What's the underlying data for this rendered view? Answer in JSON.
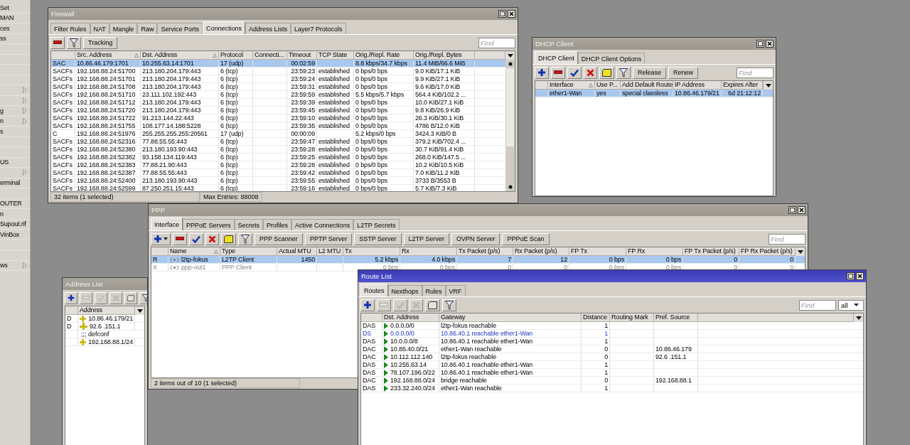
{
  "sidebar": {
    "items": [
      {
        "label": "Set",
        "submenu": false
      },
      {
        "label": "MAN",
        "submenu": false
      },
      {
        "label": "ces",
        "submenu": false
      },
      {
        "label": "ss",
        "submenu": false
      },
      {
        "submenu": false
      },
      {
        "submenu": false
      },
      {
        "submenu": false
      },
      {
        "submenu": false
      },
      {
        "submenu": true
      },
      {
        "submenu": true
      },
      {
        "label": "g",
        "submenu": true
      },
      {
        "label": "n",
        "submenu": true
      },
      {
        "label": "s",
        "submenu": false
      },
      {
        "submenu": false
      },
      {
        "submenu": false
      },
      {
        "label": "US",
        "submenu": false
      },
      {
        "submenu": true
      },
      {
        "label": "erminal",
        "submenu": false
      },
      {
        "submenu": false
      },
      {
        "label": "OUTER",
        "submenu": false
      },
      {
        "label": "n",
        "submenu": false
      },
      {
        "label": "Supout.rif",
        "submenu": false
      },
      {
        "label": "VinBox",
        "submenu": false
      },
      {
        "submenu": false
      },
      {
        "submenu": false
      },
      {
        "label": "ws",
        "submenu": true
      }
    ]
  },
  "windows": [
    {
      "kind": "firewall",
      "title": "Firewall",
      "active": false,
      "tabs": [
        {
          "label": "Filter Rules",
          "selected": false
        },
        {
          "label": "NAT",
          "selected": false
        },
        {
          "label": "Mangle",
          "selected": false
        },
        {
          "label": "Raw",
          "selected": false
        },
        {
          "label": "Service Ports",
          "selected": false
        },
        {
          "label": "Connections",
          "selected": true
        },
        {
          "label": "Address Lists",
          "selected": false
        },
        {
          "label": "Layer7 Protocols",
          "selected": false
        }
      ],
      "toolbar": [
        {
          "kind": "remove",
          "disabled": false
        },
        {
          "kind": "filter",
          "disabled": false
        },
        {
          "kind": "text",
          "label": "Tracking",
          "disabled": false
        }
      ],
      "find": {
        "placeholder": "Find"
      },
      "table": {
        "columns": [
          {
            "kind": "text",
            "sorted": false
          },
          {
            "label": "Src. Address",
            "kind": "text",
            "sorted": true
          },
          {
            "label": "Dst. Address",
            "kind": "text",
            "sorted": true
          },
          {
            "label": "Protocol",
            "kind": "text",
            "sorted": false
          },
          {
            "label": "Connecti...",
            "kind": "text",
            "sorted": false
          },
          {
            "label": "Timeout",
            "kind": "number",
            "sorted": false
          },
          {
            "label": "TCP State",
            "kind": "text",
            "sorted": false
          },
          {
            "label": "Orig./Repl. Rate",
            "kind": "text",
            "sorted": false
          },
          {
            "label": "Orig./Repl. Bytes",
            "kind": "text",
            "sorted": false
          }
        ],
        "rows": [
          {
            "selected": true,
            "cells": [
              "SAC",
              "10.86.46.179:1701",
              "10.255.63.14:1701",
              "17 (udp)",
              null,
              "00:02:59",
              null,
              "8.8 kbps/34.7 kbps",
              "11.4 MiB/66.6 MiB"
            ]
          },
          {
            "selected": false,
            "cells": [
              "SACFs",
              "192.168.88.24:51700",
              "213.180.204.179:443",
              "6 (tcp)",
              null,
              "23:59:23",
              "established",
              "0 bps/0 bps",
              "9.0 KiB/17.1 KiB"
            ]
          },
          {
            "selected": false,
            "cells": [
              "SACFs",
              "192.168.88.24:51701",
              "213.180.204.179:443",
              "6 (tcp)",
              null,
              "23:59:24",
              "established",
              "0 bps/0 bps",
              "9.9 KiB/27.1 KiB"
            ]
          },
          {
            "selected": false,
            "cells": [
              "SACFs",
              "192.168.88.24:51708",
              "213.180.204.179:443",
              "6 (tcp)",
              null,
              "23:59:31",
              "established",
              "0 bps/0 bps",
              "9.6 KiB/17.0 KiB"
            ]
          },
          {
            "selected": false,
            "cells": [
              "SACFs",
              "192.168.88.24:51710",
              "23.111.102.192:443",
              "6 (tcp)",
              null,
              "23:59:59",
              "established",
              "5.5 kbps/5.7 kbps",
              "564.4 KiB/102.2 ..."
            ]
          },
          {
            "selected": false,
            "cells": [
              "SACFs",
              "192.168.88.24:51712",
              "213.180.204.179:443",
              "6 (tcp)",
              null,
              "23:59:39",
              "established",
              "0 bps/0 bps",
              "10.0 KiB/27.1 KiB"
            ]
          },
          {
            "selected": false,
            "cells": [
              "SACFs",
              "192.168.88.24:51720",
              "213.180.204.179:443",
              "6 (tcp)",
              null,
              "23:59:45",
              "established",
              "0 bps/0 bps",
              "9.8 KiB/26.9 KiB"
            ]
          },
          {
            "selected": false,
            "cells": [
              "SACFs",
              "192.168.88.24:51722",
              "91.213.144.22:443",
              "6 (tcp)",
              null,
              "23:59:10",
              "established",
              "0 bps/0 bps",
              "26.3 KiB/30.1 KiB"
            ]
          },
          {
            "selected": false,
            "cells": [
              "SACFs",
              "192.168.88.24:51755",
              "108.177.14.188:5228",
              "6 (tcp)",
              null,
              "23:59:35",
              "established",
              "0 bps/0 bps",
              "4786 B/12.0 KiB"
            ]
          },
          {
            "selected": false,
            "cells": [
              "C",
              "192.168.88.24:51976",
              "255.255.255.255:20561",
              "17 (udp)",
              null,
              "00:00:09",
              null,
              "5.2 kbps/0 bps",
              "3424.3 KiB/0 B"
            ]
          },
          {
            "selected": false,
            "cells": [
              "SACFs",
              "192.168.88.24:52316",
              "77.88.55.55:443",
              "6 (tcp)",
              null,
              "23:59:47",
              "established",
              "0 bps/0 bps",
              "379.2 KiB/702.4 ..."
            ]
          },
          {
            "selected": false,
            "cells": [
              "SACFs",
              "192.168.88.24:52380",
              "213.180.193.90:443",
              "6 (tcp)",
              null,
              "23:59:28",
              "established",
              "0 bps/0 bps",
              "30.7 KiB/91.4 KiB"
            ]
          },
          {
            "selected": false,
            "cells": [
              "SACFs",
              "192.168.88.24:52382",
              "93.158.134.119:443",
              "6 (tcp)",
              null,
              "23:59:25",
              "established",
              "0 bps/0 bps",
              "268.0 KiB/147.5 ..."
            ]
          },
          {
            "selected": false,
            "cells": [
              "SACFs",
              "192.168.88.24:52383",
              "77.88.21.90:443",
              "6 (tcp)",
              null,
              "23:59:28",
              "established",
              "0 bps/0 bps",
              "10.2 KiB/10.5 KiB"
            ]
          },
          {
            "selected": false,
            "cells": [
              "SACFs",
              "192.168.88.24:52387",
              "77.88.55.55:443",
              "6 (tcp)",
              null,
              "23:59:42",
              "established",
              "0 bps/0 bps",
              "7.0 KiB/11.2 KiB"
            ]
          },
          {
            "selected": false,
            "cells": [
              "SACFs",
              "192.168.88.24:52400",
              "213.180.193.90:443",
              "6 (tcp)",
              null,
              "23:59:55",
              "established",
              "0 bps/0 bps",
              "3733 B/3553 B"
            ]
          },
          {
            "selected": false,
            "cells": [
              "SACFs",
              "192.168.88.24:52599",
              "87.250.251.15:443",
              "6 (tcp)",
              null,
              "23:59:16",
              "established",
              "0 bps/0 bps",
              "5.7 KiB/7.3 KiB"
            ]
          }
        ]
      },
      "status_bar": [
        "32 items (1 selected)",
        "Max Entries: 88008"
      ]
    },
    {
      "kind": "dhcp",
      "title": "DHCP Client",
      "active": false,
      "tabs": [
        {
          "label": "DHCP Client",
          "selected": true
        },
        {
          "label": "DHCP Client Options",
          "selected": false
        }
      ],
      "toolbar": [
        {
          "kind": "add",
          "disabled": false
        },
        {
          "kind": "remove",
          "disabled": false
        },
        {
          "kind": "enable",
          "disabled": false
        },
        {
          "kind": "disable",
          "disabled": false
        },
        {
          "kind": "comment",
          "disabled": false
        },
        {
          "kind": "filter",
          "disabled": false
        },
        {
          "kind": "text",
          "label": "Release",
          "disabled": false
        },
        {
          "kind": "text",
          "label": "Renew",
          "disabled": false
        }
      ],
      "find": {
        "placeholder": "Find"
      },
      "table": {
        "columns": [
          {
            "kind": "text",
            "sorted": false
          },
          {
            "label": "Interface",
            "kind": "text",
            "sorted": true
          },
          {
            "label": "Use P...",
            "kind": "text",
            "sorted": false
          },
          {
            "label": "Add Default Route",
            "kind": "text",
            "sorted": false
          },
          {
            "label": "IP Address",
            "kind": "text",
            "sorted": false
          },
          {
            "label": "Expires After",
            "kind": "number",
            "sorted": false
          }
        ],
        "rows": [
          {
            "selected": true,
            "cells": [
              null,
              "ether1-Wan",
              "yes",
              "special classless",
              "10.86.46.179/21",
              "6d 21:12:12"
            ]
          }
        ]
      }
    },
    {
      "kind": "address",
      "title": "Address List",
      "active": false,
      "toolbar": [
        {
          "kind": "add",
          "disabled": false
        },
        {
          "kind": "remove",
          "disabled": true
        },
        {
          "kind": "enable",
          "disabled": true
        },
        {
          "kind": "disable",
          "disabled": true
        },
        {
          "kind": "comment",
          "disabled": true
        },
        {
          "kind": "filter",
          "disabled": false
        }
      ],
      "table": {
        "columns": [
          {
            "kind": "text",
            "sorted": false
          },
          {
            "label": "Address",
            "kind": "address",
            "sorted": false
          }
        ],
        "rows": [
          {
            "kind": "entry",
            "selected": false,
            "cells": [
              "D",
              "10.86.46.179/21"
            ]
          },
          {
            "kind": "entry",
            "selected": false,
            "cells": [
              "D",
              "92.6 .151.1"
            ]
          },
          {
            "kind": "comment",
            "selected": false,
            "comment": ";;; defconf"
          },
          {
            "kind": "entry",
            "selected": false,
            "cells": [
              null,
              "192.168.88.1/24"
            ]
          }
        ]
      }
    },
    {
      "kind": "ppp",
      "title": "PPP",
      "active": false,
      "tabs": [
        {
          "label": "Interface",
          "selected": true
        },
        {
          "label": "PPPoE Servers",
          "selected": false
        },
        {
          "label": "Secrets",
          "selected": false
        },
        {
          "label": "Profiles",
          "selected": false
        },
        {
          "label": "Active Connections",
          "selected": false
        },
        {
          "label": "L2TP Secrets",
          "selected": false
        }
      ],
      "toolbar": [
        {
          "kind": "add-menu",
          "disabled": false
        },
        {
          "kind": "remove",
          "disabled": false
        },
        {
          "kind": "enable",
          "disabled": false
        },
        {
          "kind": "disable",
          "disabled": false
        },
        {
          "kind": "comment",
          "disabled": false
        },
        {
          "kind": "filter",
          "disabled": false
        },
        {
          "kind": "text",
          "label": "PPP Scanner",
          "disabled": false
        },
        {
          "kind": "text",
          "label": "PPTP Server",
          "disabled": false
        },
        {
          "kind": "text",
          "label": "SSTP Server",
          "disabled": false
        },
        {
          "kind": "text",
          "label": "L2TP Server",
          "disabled": false
        },
        {
          "kind": "text",
          "label": "OVPN Server",
          "disabled": false
        },
        {
          "kind": "text",
          "label": "PPPoE Scan",
          "disabled": false
        }
      ],
      "find": {
        "placeholder": "Find"
      },
      "table": {
        "columns": [
          {
            "kind": "text",
            "sorted": false
          },
          {
            "label": "Name",
            "kind": "interface",
            "sorted": true
          },
          {
            "label": "Type",
            "kind": "text",
            "sorted": false
          },
          {
            "label": "Actual MTU",
            "kind": "number",
            "sorted": false
          },
          {
            "label": "L2 MTU",
            "kind": "number",
            "sorted": false
          },
          {
            "label": "Tx",
            "kind": "number",
            "sorted": false
          },
          {
            "label": "Rx",
            "kind": "number",
            "sorted": false
          },
          {
            "label": "Tx Packet (p/s)",
            "kind": "number",
            "sorted": false
          },
          {
            "label": "Rx Packet (p/s)",
            "kind": "number",
            "sorted": false
          },
          {
            "label": "FP Tx",
            "kind": "number",
            "sorted": false
          },
          {
            "label": "FP Rx",
            "kind": "number",
            "sorted": false
          },
          {
            "label": "FP Tx Packet (p/s)",
            "kind": "number",
            "sorted": false
          },
          {
            "label": "FP Rx Packet (p/s)",
            "kind": "number",
            "sorted": false
          }
        ],
        "rows": [
          {
            "selected": true,
            "disabled": false,
            "cells": [
              "R",
              "l2tp-fokus",
              "L2TP Client",
              "1450",
              null,
              "5.2 kbps",
              "4.0 kbps",
              "7",
              "12",
              "0 bps",
              "0 bps",
              "0",
              "0"
            ]
          },
          {
            "selected": false,
            "disabled": true,
            "cells": [
              "X",
              "ppp-out1",
              "PPP Client",
              null,
              null,
              "0 bps",
              "0 bps",
              "0",
              "0",
              "0 bps",
              "0 bps",
              "0",
              "0"
            ]
          }
        ]
      },
      "status_bar": [
        "2 items out of 10 (1 selected)"
      ]
    },
    {
      "kind": "route",
      "title": "Route List",
      "active": true,
      "tabs": [
        {
          "label": "Routes",
          "selected": true
        },
        {
          "label": "Nexthops",
          "selected": false
        },
        {
          "label": "Rules",
          "selected": false
        },
        {
          "label": "VRF",
          "selected": false
        }
      ],
      "toolbar": [
        {
          "kind": "add",
          "disabled": false
        },
        {
          "kind": "remove",
          "disabled": true
        },
        {
          "kind": "enable",
          "disabled": true
        },
        {
          "kind": "disable",
          "disabled": true
        },
        {
          "kind": "comment",
          "disabled": true
        },
        {
          "kind": "filter",
          "disabled": false
        }
      ],
      "find": {
        "placeholder": "Find"
      },
      "dropdown": {
        "value": "all"
      },
      "table": {
        "columns": [
          {
            "kind": "text",
            "sorted": false
          },
          {
            "label": "Dst. Address",
            "kind": "route",
            "sorted": false
          },
          {
            "label": "Gateway",
            "kind": "text",
            "sorted": false
          },
          {
            "label": "Distance",
            "kind": "number",
            "sorted": false
          },
          {
            "label": "Routing Mark",
            "kind": "text",
            "sorted": false
          },
          {
            "label": "Pref. Source",
            "kind": "text",
            "sorted": false
          }
        ],
        "rows": [
          {
            "selected": false,
            "active": true,
            "cells": [
              "DAS",
              "0.0.0.0/0",
              "l2tp-fokus reachable",
              "1",
              null,
              null
            ]
          },
          {
            "selected": false,
            "active": false,
            "cells": [
              "DS",
              "0.0.0.0/0",
              "10.86.40.1 reachable ether1-Wan",
              "1",
              null,
              null
            ]
          },
          {
            "selected": false,
            "active": true,
            "cells": [
              "DAS",
              "10.0.0.0/8",
              "10.86.40.1 reachable ether1-Wan",
              "1",
              null,
              null
            ]
          },
          {
            "selected": false,
            "active": true,
            "cells": [
              "DAC",
              "10.86.40.0/21",
              "ether1-Wan reachable",
              "0",
              null,
              "10.86.46.179"
            ]
          },
          {
            "selected": false,
            "active": true,
            "cells": [
              "DAC",
              "10.112.112.140",
              "l2tp-fokus reachable",
              "0",
              null,
              "92.6 .151.1"
            ]
          },
          {
            "selected": false,
            "active": true,
            "cells": [
              "DAS",
              "10.255.63.14",
              "10.86.40.1 reachable ether1-Wan",
              "1",
              null,
              null
            ]
          },
          {
            "selected": false,
            "active": true,
            "cells": [
              "DAS",
              "78.107.196.0/22",
              "10.86.40.1 reachable ether1-Wan",
              "1",
              null,
              null
            ]
          },
          {
            "selected": false,
            "active": true,
            "cells": [
              "DAC",
              "192.168.88.0/24",
              "bridge reachable",
              "0",
              null,
              "192.168.88.1"
            ]
          },
          {
            "selected": false,
            "active": true,
            "cells": [
              "DAS",
              "233.32.240.0/24",
              "ether1-Wan reachable",
              "1",
              null,
              null
            ]
          }
        ]
      }
    }
  ]
}
